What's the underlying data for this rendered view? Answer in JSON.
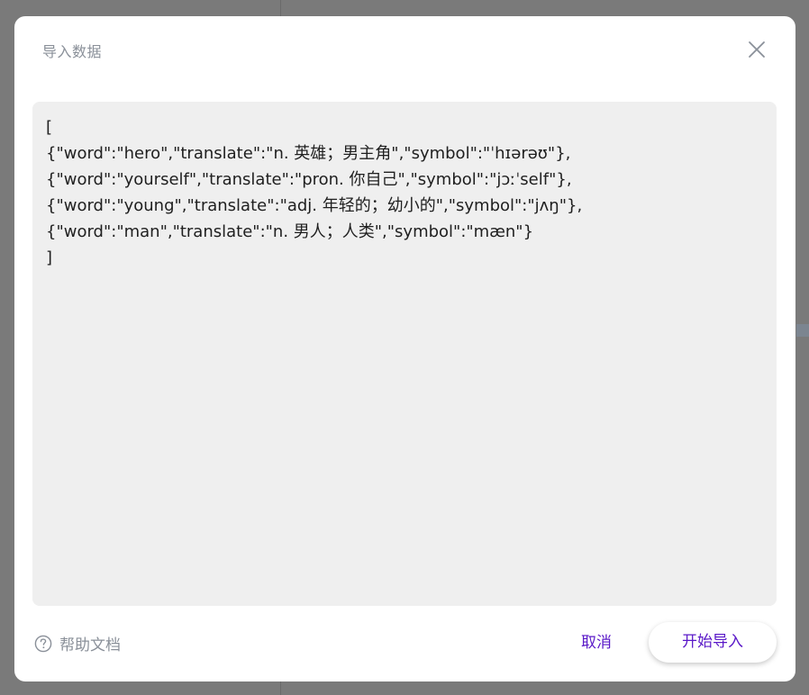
{
  "dialog": {
    "title": "导入数据",
    "close_icon": "close-icon",
    "textarea": {
      "lines": [
        "[",
        "{\"word\":\"hero\",\"translate\":\"n. 英雄；男主角\",\"symbol\":\"ˈhɪərəʊ\"},",
        "{\"word\":\"yourself\",\"translate\":\"pron. 你自己\",\"symbol\":\"jɔːˈself\"},",
        "{\"word\":\"young\",\"translate\":\"adj. 年轻的；幼小的\",\"symbol\":\"jʌŋ\"},",
        "{\"word\":\"man\",\"translate\":\"n. 男人；人类\",\"symbol\":\"mæn\"}",
        "]"
      ]
    },
    "footer": {
      "help_icon": "question-circle-icon",
      "help_label": "帮助文档",
      "cancel_label": "取消",
      "start_label": "开始导入"
    }
  },
  "colors": {
    "accent": "#5a18c8",
    "muted_text": "#8a9099",
    "textarea_bg": "#efefef",
    "overlay": "#7a7a7a"
  }
}
